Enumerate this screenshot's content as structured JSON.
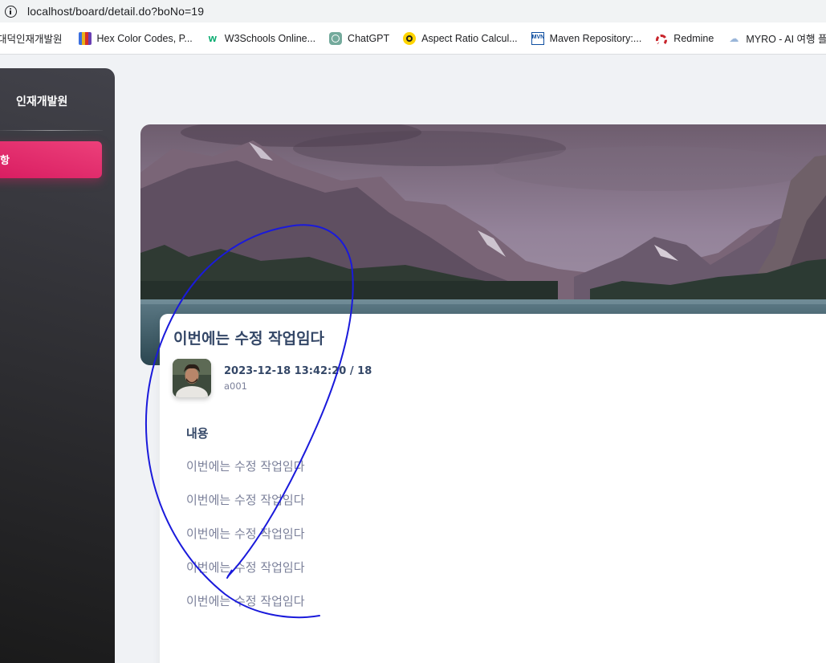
{
  "browser": {
    "url": "localhost/board/detail.do?boNo=19",
    "bookmarks": [
      {
        "label": "대덕인재개발원",
        "icon": "none"
      },
      {
        "label": "Hex Color Codes, P...",
        "icon": "books-icon"
      },
      {
        "label": "W3Schools Online...",
        "icon": "w3schools-icon"
      },
      {
        "label": "ChatGPT",
        "icon": "chatgpt-icon"
      },
      {
        "label": "Aspect Ratio Calcul...",
        "icon": "aspect-ratio-icon"
      },
      {
        "label": "Maven Repository:...",
        "icon": "maven-icon"
      },
      {
        "label": "Redmine",
        "icon": "redmine-icon"
      },
      {
        "label": "MYRO - AI 여행 플...",
        "icon": "myro-icon"
      }
    ]
  },
  "sidebar": {
    "brand": "인재개발원",
    "active_item": "항"
  },
  "post": {
    "title": "이번에는 수정 작업임다",
    "date": "2023-12-18 13:42:20",
    "separator": "/",
    "views": "18",
    "author": "a001",
    "content_label": "내용",
    "content_lines": [
      "이번에는 수정 작업임다",
      "이번에는 수정 작업임다",
      "이번에는 수정 작업임다",
      "이번에는 수정 작업임다",
      "이번에는 수정 작업임다"
    ]
  },
  "colors": {
    "accent": "#e91e63",
    "sidebar_dark": "#191919",
    "annotation_ink": "#1a1adb",
    "title_text": "#344767",
    "muted_text": "#7b809a"
  }
}
